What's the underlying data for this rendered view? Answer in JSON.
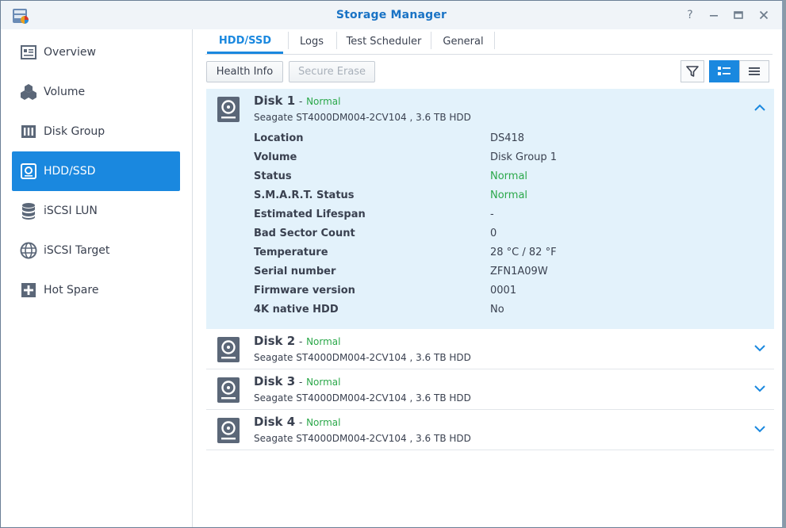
{
  "window": {
    "title": "Storage Manager"
  },
  "window_controls": {
    "help": "?",
    "minimize": "—",
    "maximize": "▭",
    "close": "✕"
  },
  "sidebar": {
    "items": [
      {
        "label": "Overview",
        "icon": "overview-icon",
        "active": false
      },
      {
        "label": "Volume",
        "icon": "volume-icon",
        "active": false
      },
      {
        "label": "Disk Group",
        "icon": "disk-group-icon",
        "active": false
      },
      {
        "label": "HDD/SSD",
        "icon": "hdd-icon",
        "active": true
      },
      {
        "label": "iSCSI LUN",
        "icon": "iscsi-lun-icon",
        "active": false
      },
      {
        "label": "iSCSI Target",
        "icon": "iscsi-target-icon",
        "active": false
      },
      {
        "label": "Hot Spare",
        "icon": "hot-spare-icon",
        "active": false
      }
    ]
  },
  "tabs": [
    {
      "label": "HDD/SSD",
      "active": true
    },
    {
      "label": "Logs",
      "active": false
    },
    {
      "label": "Test Scheduler",
      "active": false
    },
    {
      "label": "General",
      "active": false
    }
  ],
  "toolbar": {
    "health_info": "Health Info",
    "secure_erase": "Secure Erase"
  },
  "colors": {
    "accent": "#1a88df",
    "status_normal": "#2ba84a",
    "expanded_bg": "#e3f2fb"
  },
  "disks": [
    {
      "name": "Disk 1",
      "status": "Normal",
      "model": "Seagate ST4000DM004-2CV104 , 3.6 TB HDD",
      "expanded": true,
      "details": [
        {
          "label": "Location",
          "value": "DS418"
        },
        {
          "label": "Volume",
          "value": "Disk Group 1"
        },
        {
          "label": "Status",
          "value": "Normal"
        },
        {
          "label": "S.M.A.R.T. Status",
          "value": "Normal"
        },
        {
          "label": "Estimated Lifespan",
          "value": "-"
        },
        {
          "label": "Bad Sector Count",
          "value": "0"
        },
        {
          "label": "Temperature",
          "value": "28 °C / 82 °F"
        },
        {
          "label": "Serial number",
          "value": "ZFN1A09W"
        },
        {
          "label": "Firmware version",
          "value": "0001"
        },
        {
          "label": "4K native HDD",
          "value": "No"
        }
      ]
    },
    {
      "name": "Disk 2",
      "status": "Normal",
      "model": "Seagate ST4000DM004-2CV104 , 3.6 TB HDD",
      "expanded": false
    },
    {
      "name": "Disk 3",
      "status": "Normal",
      "model": "Seagate ST4000DM004-2CV104 , 3.6 TB HDD",
      "expanded": false
    },
    {
      "name": "Disk 4",
      "status": "Normal",
      "model": "Seagate ST4000DM004-2CV104 , 3.6 TB HDD",
      "expanded": false
    }
  ]
}
